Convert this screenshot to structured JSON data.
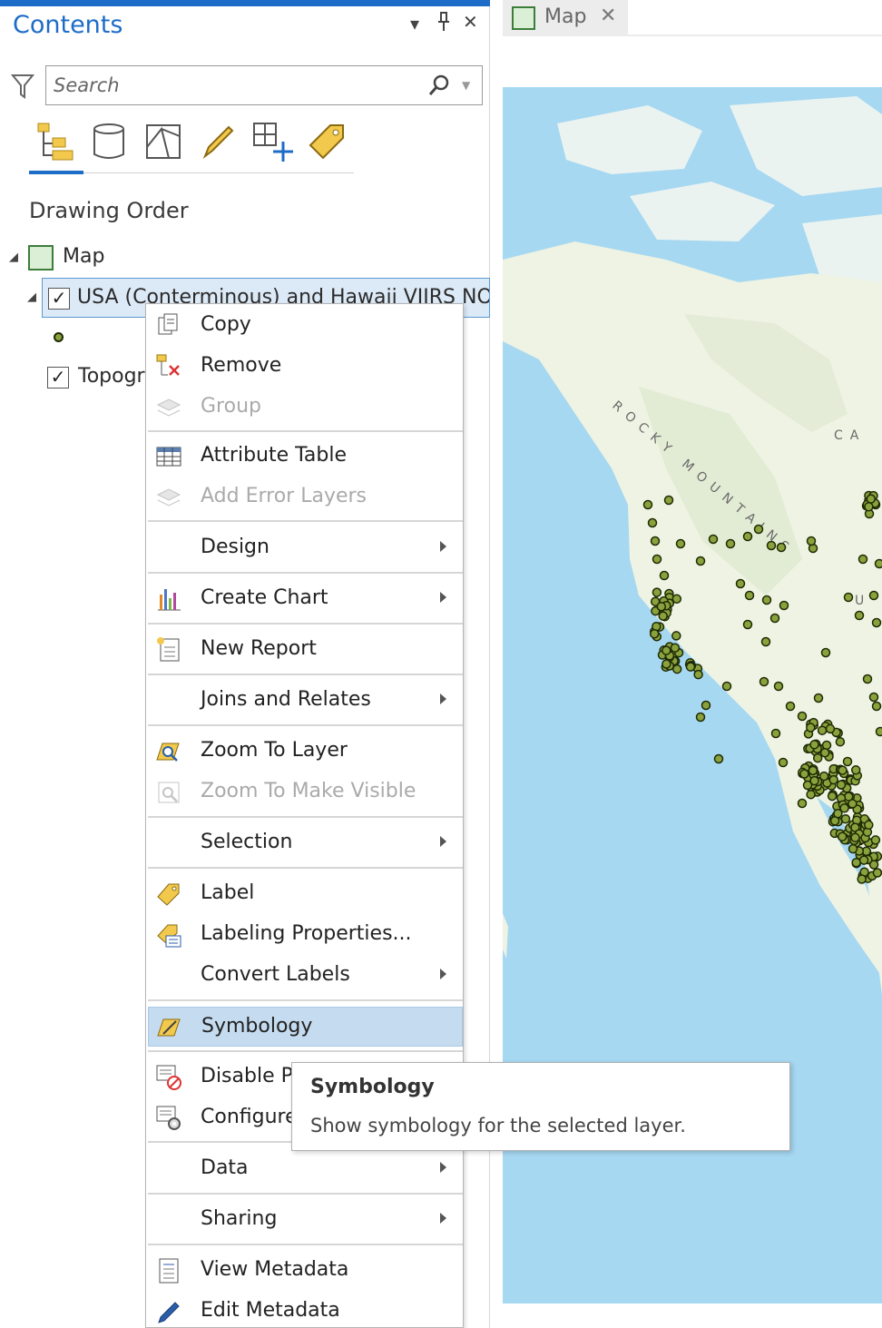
{
  "contents_pane": {
    "title": "Contents",
    "controls": {
      "dropdown": "▾",
      "pin": "⊥",
      "close": "✕"
    },
    "search": {
      "placeholder": "Search",
      "value": ""
    },
    "toolbar": [
      {
        "icon": "list-by-drawing-order-icon",
        "active": true
      },
      {
        "icon": "list-by-data-source-icon"
      },
      {
        "icon": "list-by-selection-icon"
      },
      {
        "icon": "list-by-editing-icon"
      },
      {
        "icon": "list-by-snapping-icon"
      },
      {
        "icon": "list-by-labeling-icon"
      }
    ],
    "section_title": "Drawing Order",
    "tree": {
      "map_label": "Map",
      "layer1_label": "USA (Conterminous) and Hawaii VIIRS NOAA-",
      "layer2_label": "Topogra",
      "layer1_checked": true,
      "layer2_checked": true
    }
  },
  "map_view": {
    "tab_label": "Map",
    "labels": {
      "rocky": "ROCKY MOUNTAINS",
      "ca": "CA",
      "us": "U"
    }
  },
  "context_menu": {
    "items": [
      {
        "label": "Copy",
        "icon": "copy-icon",
        "enabled": true
      },
      {
        "label": "Remove",
        "icon": "remove-layer-icon",
        "enabled": true
      },
      {
        "label": "Group",
        "icon": "group-layers-icon",
        "enabled": false
      },
      {
        "label": "Attribute Table",
        "icon": "attribute-table-icon",
        "enabled": true
      },
      {
        "label": "Add Error Layers",
        "icon": "add-error-layers-icon",
        "enabled": false
      },
      {
        "label": "Design",
        "submenu": true
      },
      {
        "label": "Create Chart",
        "icon": "create-chart-icon",
        "submenu": true
      },
      {
        "label": "New Report",
        "icon": "new-report-icon"
      },
      {
        "label": "Joins and Relates",
        "submenu": true
      },
      {
        "label": "Zoom To Layer",
        "icon": "zoom-to-layer-icon"
      },
      {
        "label": "Zoom To Make Visible",
        "icon": "zoom-to-make-visible-icon",
        "enabled": false
      },
      {
        "label": "Selection",
        "submenu": true
      },
      {
        "label": "Label",
        "icon": "label-icon"
      },
      {
        "label": "Labeling Properties...",
        "icon": "labeling-properties-icon"
      },
      {
        "label": "Convert Labels",
        "submenu": true
      },
      {
        "label": "Symbology",
        "icon": "symbology-icon",
        "highlighted": true
      },
      {
        "label": "Disable Po",
        "icon": "disable-popups-icon"
      },
      {
        "label": "Configure",
        "icon": "configure-popups-icon"
      },
      {
        "label": "Data",
        "submenu": true
      },
      {
        "label": "Sharing",
        "submenu": true
      },
      {
        "label": "View Metadata",
        "icon": "view-metadata-icon"
      },
      {
        "label": "Edit Metadata",
        "icon": "edit-metadata-icon"
      }
    ]
  },
  "tooltip": {
    "title": "Symbology",
    "description": "Show symbology for the selected layer."
  },
  "colors": {
    "accent": "#1d6cc7",
    "selection": "#dce9f6",
    "menu_highlight": "#c5dcf0",
    "ocean": "#a6d8f2",
    "land": "#eef3e3",
    "point_fill": "#8aa23c",
    "point_stroke": "#1f2a05"
  }
}
